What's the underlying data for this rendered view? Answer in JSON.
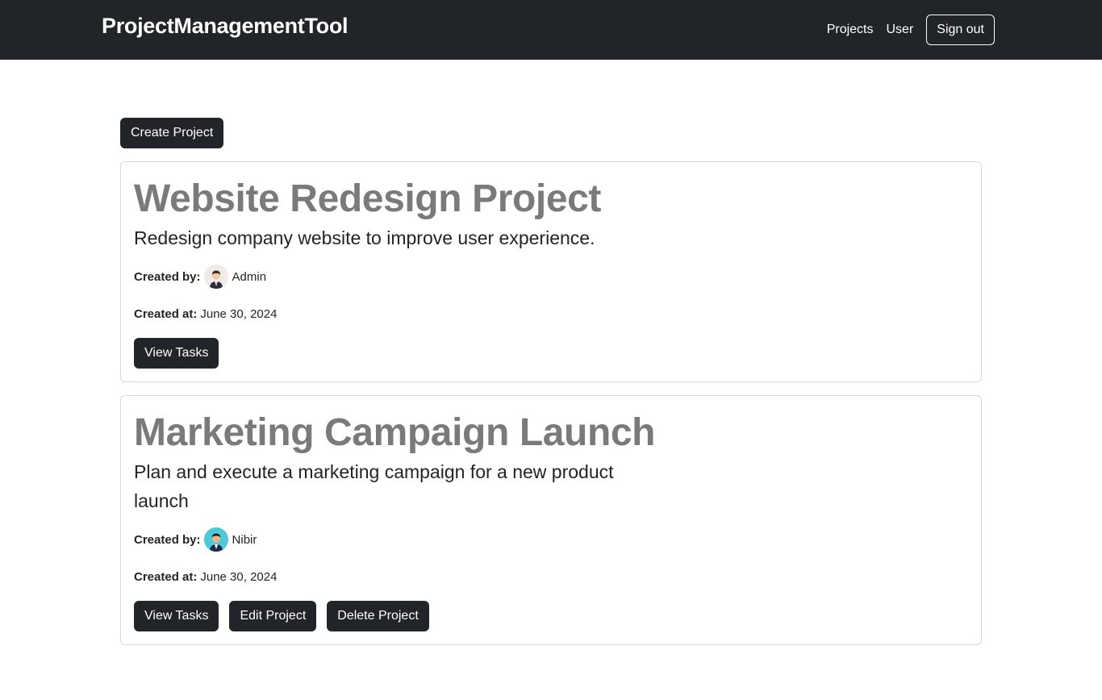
{
  "navbar": {
    "brand": "ProjectManagementTool",
    "links": [
      "Projects",
      "User"
    ],
    "signout_label": "Sign out"
  },
  "create_project_label": "Create Project",
  "projects": [
    {
      "title": "Website Redesign Project",
      "description": "Redesign company website to improve user experience.",
      "created_by_label": "Created by:",
      "created_by": "Admin",
      "created_at_label": "Created at:",
      "created_at": "June 30, 2024",
      "actions": [
        "View Tasks"
      ]
    },
    {
      "title": "Marketing Campaign Launch",
      "description": "Plan and execute a marketing campaign for a new product launch",
      "created_by_label": "Created by:",
      "created_by": "Nibir",
      "created_at_label": "Created at:",
      "created_at": "June 30, 2024",
      "actions": [
        "View Tasks",
        "Edit Project",
        "Delete Project"
      ]
    }
  ],
  "colors": {
    "navbar_bg": "#212529",
    "button_bg": "#212529",
    "title_color": "#7a7a7a"
  }
}
